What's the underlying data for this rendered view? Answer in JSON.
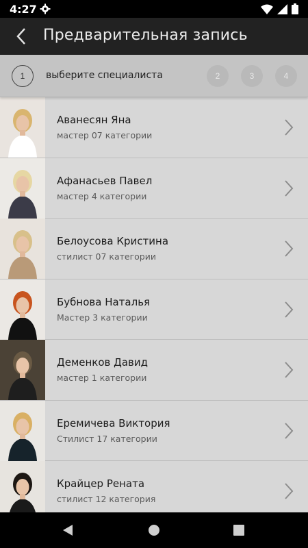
{
  "status": {
    "time": "4:27"
  },
  "app_bar": {
    "title": "Предварительная запись"
  },
  "steps": {
    "active_number": "1",
    "active_label": "выберите специалиста",
    "inactive": [
      "2",
      "3",
      "4"
    ]
  },
  "specialists": [
    {
      "name": "Аванесян Яна",
      "role": "мастер 07 категории",
      "hair": "#d9b56f",
      "top": "#ffffff",
      "bg": "#e9e4df"
    },
    {
      "name": "Афанасьев Павел",
      "role": "мастер 4 категории",
      "hair": "#e6d7a3",
      "top": "#3b3b48",
      "bg": "#eceae6"
    },
    {
      "name": "Белоусова Кристина",
      "role": "стилист 07 категории",
      "hair": "#d8c08a",
      "top": "#b99a78",
      "bg": "#e8e3dd"
    },
    {
      "name": "Бубнова Наталья",
      "role": "Мастер 3 категории",
      "hair": "#c8541e",
      "top": "#111111",
      "bg": "#ebe8e4"
    },
    {
      "name": "Деменков Давид",
      "role": "мастер 1 категории",
      "hair": "#6a5a44",
      "top": "#1e1e1e",
      "bg": "#4b4236"
    },
    {
      "name": "Еремичева Виктория",
      "role": "Стилист 17 категории",
      "hair": "#d9b064",
      "top": "#16232b",
      "bg": "#e9e7e3"
    },
    {
      "name": "Крайцер Рената",
      "role": "стилист 12 категория",
      "hair": "#1d1713",
      "top": "#1a1a1a",
      "bg": "#e7e4df"
    }
  ]
}
